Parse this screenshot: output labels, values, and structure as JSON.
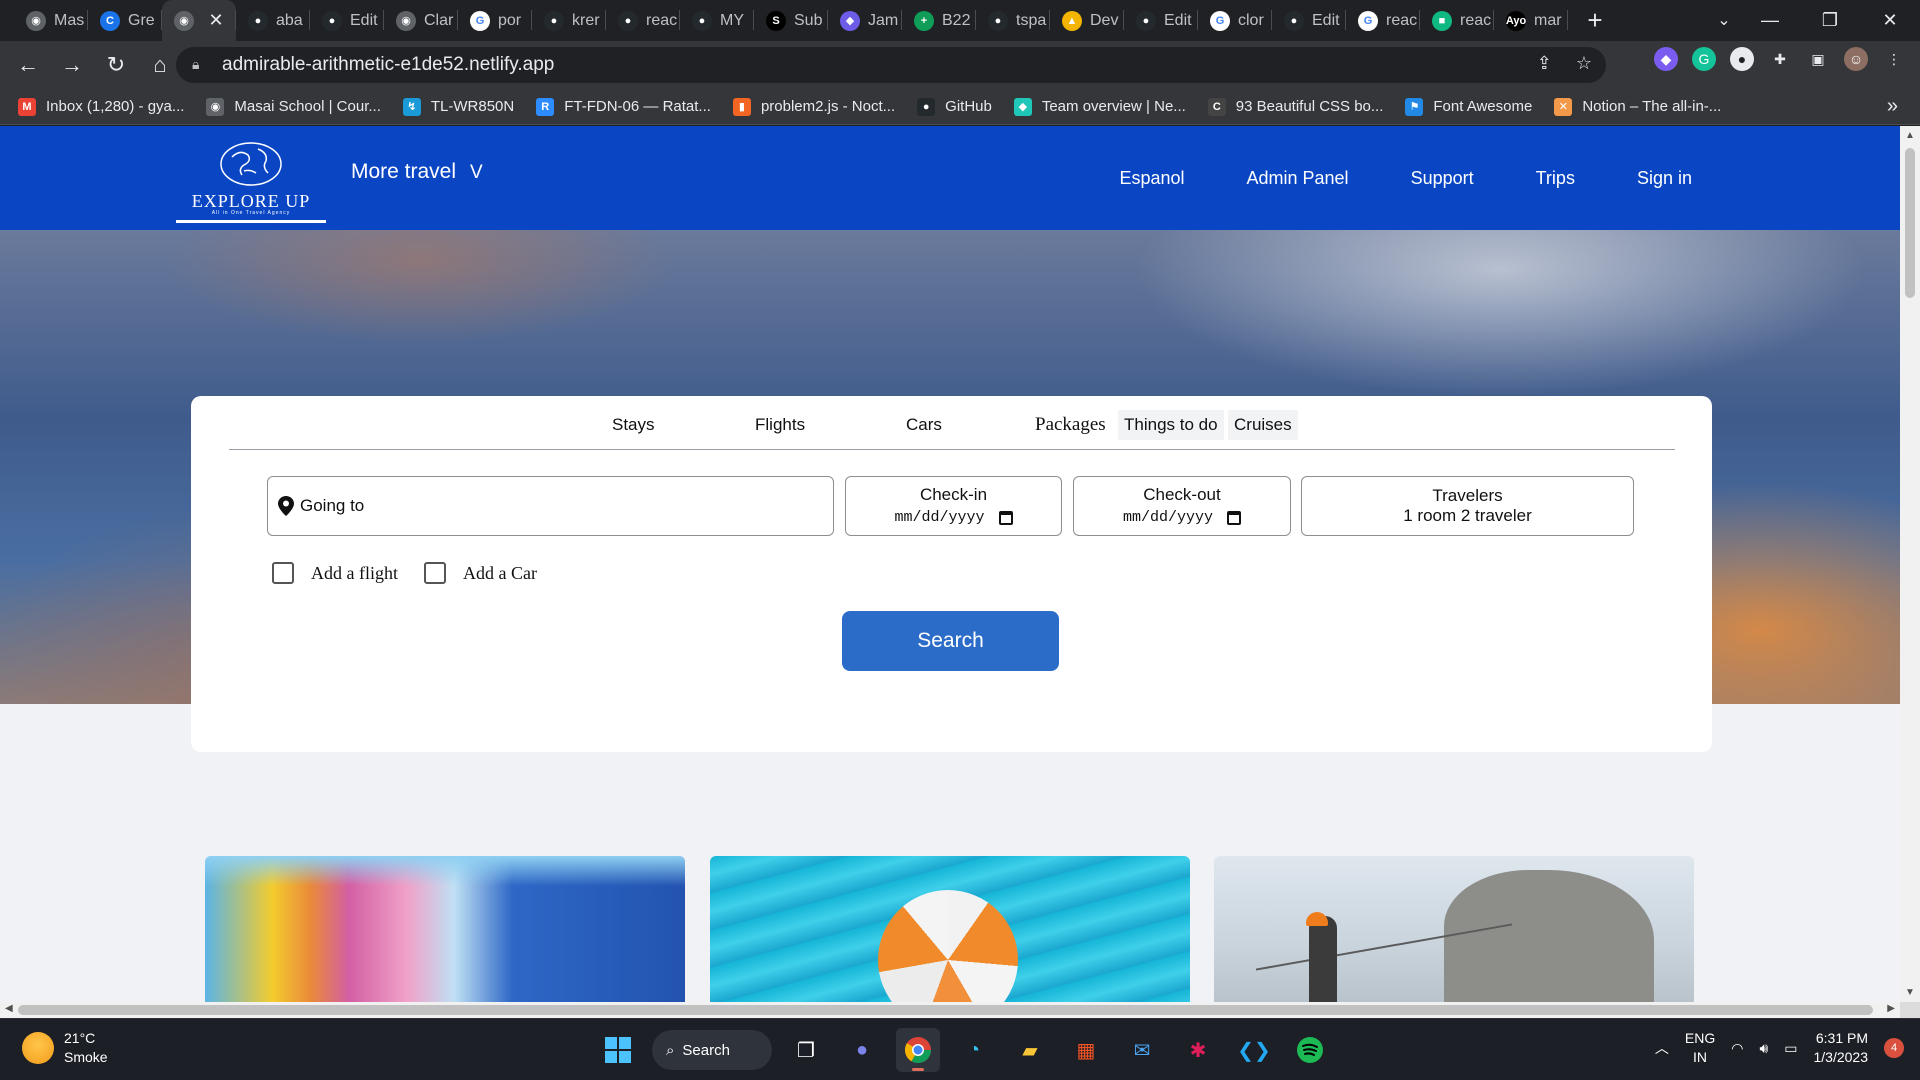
{
  "browser": {
    "tabs": [
      {
        "label": "Mas",
        "favicon_color": "#5f6368",
        "favicon_glyph": "◉"
      },
      {
        "label": "Gre",
        "favicon_color": "#1a73e8",
        "favicon_glyph": "C"
      },
      {
        "label": "",
        "favicon_color": "#5f6368",
        "favicon_glyph": "◉",
        "active": true
      },
      {
        "label": "aba",
        "favicon_color": "#24292e",
        "favicon_glyph": "●"
      },
      {
        "label": "Edit",
        "favicon_color": "#24292e",
        "favicon_glyph": "●"
      },
      {
        "label": "Clar",
        "favicon_color": "#5f6368",
        "favicon_glyph": "◉"
      },
      {
        "label": "por",
        "favicon_color": "#ffffff",
        "favicon_glyph": "G"
      },
      {
        "label": "krer",
        "favicon_color": "#24292e",
        "favicon_glyph": "●"
      },
      {
        "label": "reac",
        "favicon_color": "#24292e",
        "favicon_glyph": "●"
      },
      {
        "label": "MY",
        "favicon_color": "#24292e",
        "favicon_glyph": "●"
      },
      {
        "label": "Sub",
        "favicon_color": "#000000",
        "favicon_glyph": "S"
      },
      {
        "label": "Jam",
        "favicon_color": "#6c5ce7",
        "favicon_glyph": "◆"
      },
      {
        "label": "B22",
        "favicon_color": "#0f9d58",
        "favicon_glyph": "+"
      },
      {
        "label": "tspa",
        "favicon_color": "#24292e",
        "favicon_glyph": "●"
      },
      {
        "label": "Dev",
        "favicon_color": "#f4b400",
        "favicon_glyph": "▲"
      },
      {
        "label": "Edit",
        "favicon_color": "#24292e",
        "favicon_glyph": "●"
      },
      {
        "label": "clor",
        "favicon_color": "#ffffff",
        "favicon_glyph": "G"
      },
      {
        "label": "Edit",
        "favicon_color": "#24292e",
        "favicon_glyph": "●"
      },
      {
        "label": "reac",
        "favicon_color": "#ffffff",
        "favicon_glyph": "G"
      },
      {
        "label": "reac",
        "favicon_color": "#10b981",
        "favicon_glyph": "■"
      },
      {
        "label": "mar",
        "favicon_color": "#000000",
        "favicon_glyph": "Ayo"
      }
    ],
    "url": "admirable-arithmetic-e1de52.netlify.app",
    "bookmarks": [
      {
        "label": "Inbox (1,280) - gya...",
        "icon_color": "#ea4335",
        "glyph": "M"
      },
      {
        "label": "Masai School | Cour...",
        "icon_color": "#5f6368",
        "glyph": "◉"
      },
      {
        "label": "TL-WR850N",
        "icon_color": "#1a9bd7",
        "glyph": "↯"
      },
      {
        "label": "FT-FDN-06 — Ratat...",
        "icon_color": "#2d8cff",
        "glyph": "R"
      },
      {
        "label": "problem2.js - Noct...",
        "icon_color": "#f26522",
        "glyph": "▮"
      },
      {
        "label": "GitHub",
        "icon_color": "#24292e",
        "glyph": "●"
      },
      {
        "label": "Team overview | Ne...",
        "icon_color": "#20c6b7",
        "glyph": "◆"
      },
      {
        "label": "93 Beautiful CSS bo...",
        "icon_color": "#444444",
        "glyph": "C"
      },
      {
        "label": "Font Awesome",
        "icon_color": "#228ae6",
        "glyph": "⚑"
      },
      {
        "label": "Notion – The all-in-...",
        "icon_color": "#f2994a",
        "glyph": "✕"
      }
    ]
  },
  "site": {
    "brand": "EXPLORE UP",
    "tagline": "All in One Travel Agency",
    "more_travel": "More travel",
    "more_travel_chevron": "V",
    "nav": [
      "Espanol",
      "Admin Panel",
      "Support",
      "Trips",
      "Sign in"
    ],
    "service_tabs": [
      "Stays",
      "Flights",
      "Cars",
      "Packages",
      "Things to do",
      "Cruises"
    ],
    "going_to_placeholder": "Going to",
    "checkin_label": "Check-in",
    "checkin_value": "mm/dd/yyyy",
    "checkout_label": "Check-out",
    "checkout_value": "mm/dd/yyyy",
    "travelers_label": "Travelers",
    "travelers_value": "1 room 2 traveler",
    "add_flight": "Add a flight",
    "add_car": "Add a Car",
    "search": "Search"
  },
  "taskbar": {
    "temperature": "21°C",
    "condition": "Smoke",
    "search": "Search",
    "lang_1": "ENG",
    "lang_2": "IN",
    "time": "6:31 PM",
    "date": "1/3/2023",
    "notifications": "4"
  }
}
